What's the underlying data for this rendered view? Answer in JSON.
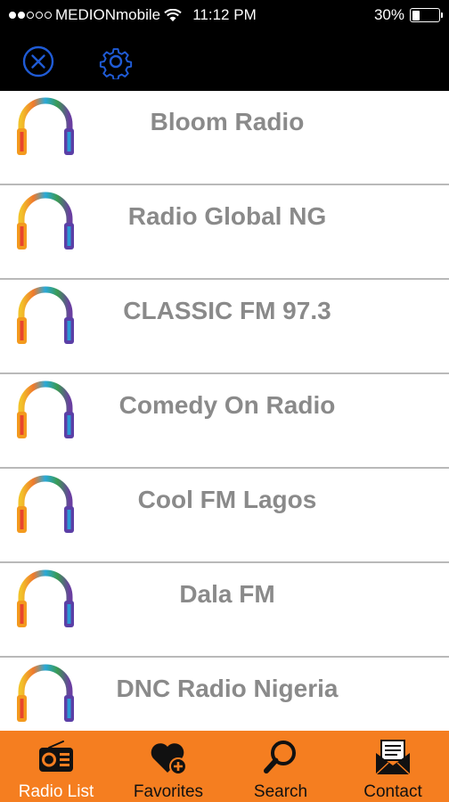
{
  "status_bar": {
    "carrier": "MEDIONmobile",
    "time": "11:12 PM",
    "battery": "30%",
    "battery_level": 0.3
  },
  "toolbar": {
    "close_icon": "close-circle-icon",
    "settings_icon": "gear-icon",
    "accent_color": "#1f5bd6"
  },
  "stations": [
    {
      "name": "Bloom Radio"
    },
    {
      "name": "Radio Global NG"
    },
    {
      "name": "CLASSIC FM 97.3"
    },
    {
      "name": "Comedy On Radio"
    },
    {
      "name": "Cool FM Lagos"
    },
    {
      "name": "Dala FM"
    },
    {
      "name": "DNC Radio Nigeria"
    }
  ],
  "tabs": [
    {
      "label": "Radio List",
      "icon": "radio-icon",
      "active": true
    },
    {
      "label": "Favorites",
      "icon": "heart-plus-icon",
      "active": false
    },
    {
      "label": "Search",
      "icon": "magnifier-icon",
      "active": false
    },
    {
      "label": "Contact",
      "icon": "envelope-icon",
      "active": false
    }
  ],
  "colors": {
    "tabbar": "#f57e20",
    "label": "#8a8a8a"
  }
}
